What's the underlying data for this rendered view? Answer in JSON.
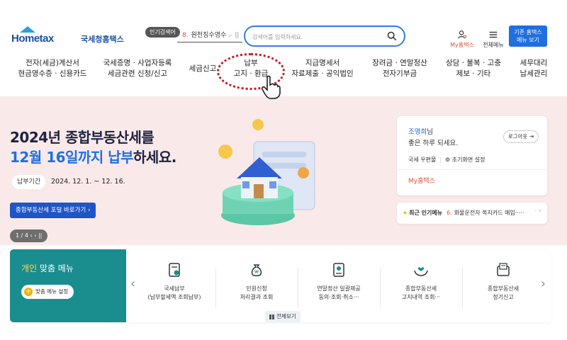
{
  "header": {
    "logo_text": "Hometax",
    "logo_sub": "국세청홈택스",
    "popular_label": "인기검색어",
    "popular_item": {
      "num": "8.",
      "text": "원천징수영수"
    },
    "search_placeholder": "검색어를 입력하세요.",
    "my_hometax": "My홈택스",
    "all_menu": "전체메뉴",
    "classic_line1": "기존 홈택스",
    "classic_line2": "메뉴 보기"
  },
  "gnb": [
    {
      "line1": "전자(세금)계산서",
      "line2": "현금영수증 · 신용카드"
    },
    {
      "line1": "국세증명 · 사업자등록",
      "line2": "세금관련 신청/신고"
    },
    {
      "line1": "세금신고",
      "line2": ""
    },
    {
      "line1": "납부",
      "line2": "고지 · 환급"
    },
    {
      "line1": "지급명세서",
      "line2": "자료제출 · 공익법인"
    },
    {
      "line1": "장려금 · 연말정산",
      "line2": "전자기부금"
    },
    {
      "line1": "상담 · 불복 · 고충",
      "line2": "제보 · 기타"
    },
    {
      "line1": "세무대리",
      "line2": "납세관리"
    }
  ],
  "hero": {
    "title_line1": "2024년 종합부동산세를",
    "title_line2_accent": "12월 16일까지 납부",
    "title_line2_rest": "하세요.",
    "period_label": "납부기간",
    "period_value": "2024. 12. 1. ~ 12. 16.",
    "portal_button": "종합부동산세 포털 바로가기 ›",
    "pager_text": "1 / 4  ‹  ›  ||"
  },
  "user": {
    "name": "조명희",
    "name_suffix": "님",
    "greeting": "좋은 하루 되세요.",
    "logout": "로그아웃 ⇥",
    "mailbox": "국세 우편물",
    "initial_settings": "⚙ 초기화면 설정",
    "my_hometax": "My홈택스"
  },
  "popular_menu": {
    "label": "최근 인기메뉴",
    "num": "6.",
    "text": "화물운전자 복지카드 매입·····",
    "nav": "˙ ˅"
  },
  "personal_menu": {
    "title_accent": "개인",
    "title_rest": " 맞춤 메뉴",
    "setting_button": "맞춤 메뉴 설정",
    "items": [
      {
        "icon": "document-check-icon",
        "line1": "국세납부",
        "line2": "(납부할세액 조회납부)"
      },
      {
        "icon": "money-bag-icon",
        "line1": "민원신청",
        "line2": "처리결과 조회"
      },
      {
        "icon": "document-stamp-icon",
        "line1": "연말정산 일괄제공",
        "line2": "동의·조회·취소···"
      },
      {
        "icon": "hands-heart-icon",
        "line1": "종합부동산세",
        "line2": "고지내역 조회···"
      },
      {
        "icon": "folder-document-icon",
        "line1": "종합부동산세",
        "line2": "정기신고"
      }
    ],
    "view_all": "전체보기"
  },
  "colors": {
    "brand_blue": "#1f6fe0",
    "navy": "#1c2342",
    "teal": "#1a8d8f",
    "hero_bg": "#f9e9e9",
    "highlight_red": "#c8181e"
  }
}
